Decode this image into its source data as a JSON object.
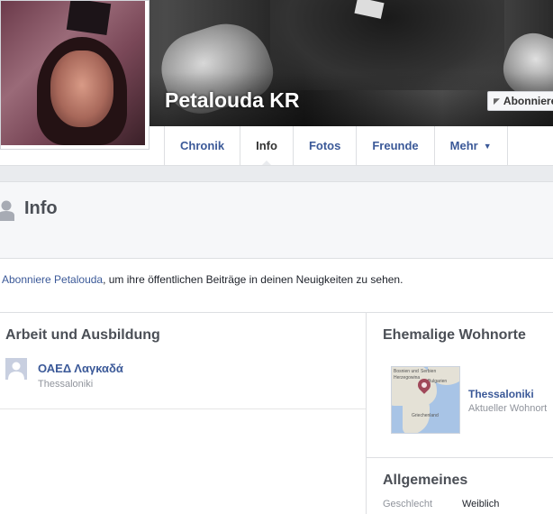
{
  "profile": {
    "name": "Petalouda KR",
    "subscribe_label": "Abonnieren"
  },
  "tabs": [
    {
      "label": "Chronik"
    },
    {
      "label": "Info"
    },
    {
      "label": "Fotos"
    },
    {
      "label": "Freunde"
    },
    {
      "label": "Mehr"
    }
  ],
  "info": {
    "title": "Info"
  },
  "notice": {
    "link": "Abonniere Petalouda",
    "text": ", um ihre öffentlichen Beiträge in deinen Neuigkeiten zu sehen."
  },
  "work": {
    "title": "Arbeit und Ausbildung",
    "items": [
      {
        "name": "ΟΑΕΔ Λαγκαδά",
        "place": "Thessaloniki"
      }
    ]
  },
  "places": {
    "title": "Ehemalige Wohnorte",
    "items": [
      {
        "name": "Thessaloniki",
        "subtitle": "Aktueller Wohnort"
      }
    ],
    "map_labels": [
      "Bosnien und",
      "Herzegowina",
      "Serbien",
      "Bulgarien",
      "Griechenland"
    ]
  },
  "general": {
    "title": "Allgemeines",
    "rows": [
      {
        "label": "Geschlecht",
        "value": "Weiblich"
      }
    ]
  },
  "colors": {
    "link": "#3b5998",
    "pin": "#a0485a"
  }
}
